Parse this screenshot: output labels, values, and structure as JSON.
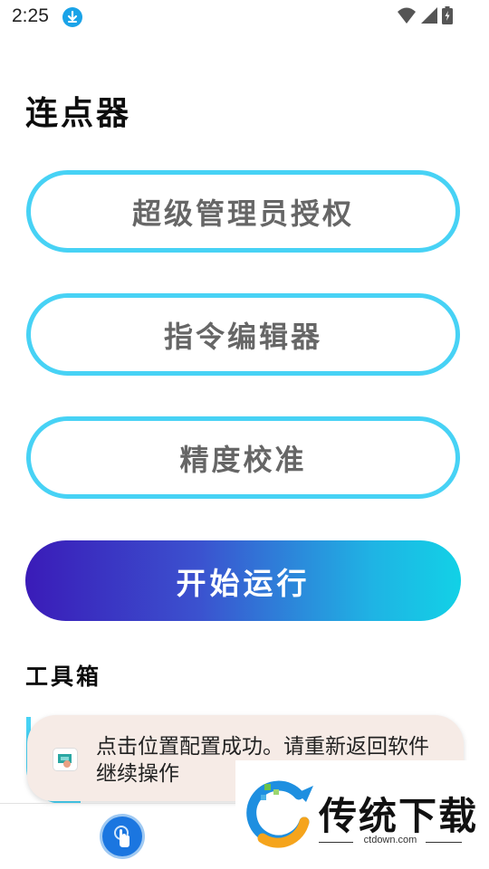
{
  "status_bar": {
    "time": "2:25"
  },
  "app": {
    "title": "连点器"
  },
  "buttons": {
    "admin_auth": "超级管理员授权",
    "command_editor": "指令编辑器",
    "precision_calibration": "精度校准",
    "start_run": "开始运行"
  },
  "toolbox": {
    "title": "工具箱"
  },
  "toast": {
    "message": "点击位置配置成功。请重新返回软件继续操作"
  },
  "watermark": {
    "name": "传统下载",
    "url": "ctdown.com"
  },
  "colors": {
    "outline_accent": "#47d2f5",
    "run_gradient_start": "#3a1bb8",
    "run_gradient_end": "#12d1e6",
    "toast_background": "#f6ebe6"
  },
  "icons": {
    "download": "download-icon",
    "wifi": "wifi-icon",
    "signal": "signal-icon",
    "battery": "battery-icon",
    "nav": "touch-click-icon"
  }
}
